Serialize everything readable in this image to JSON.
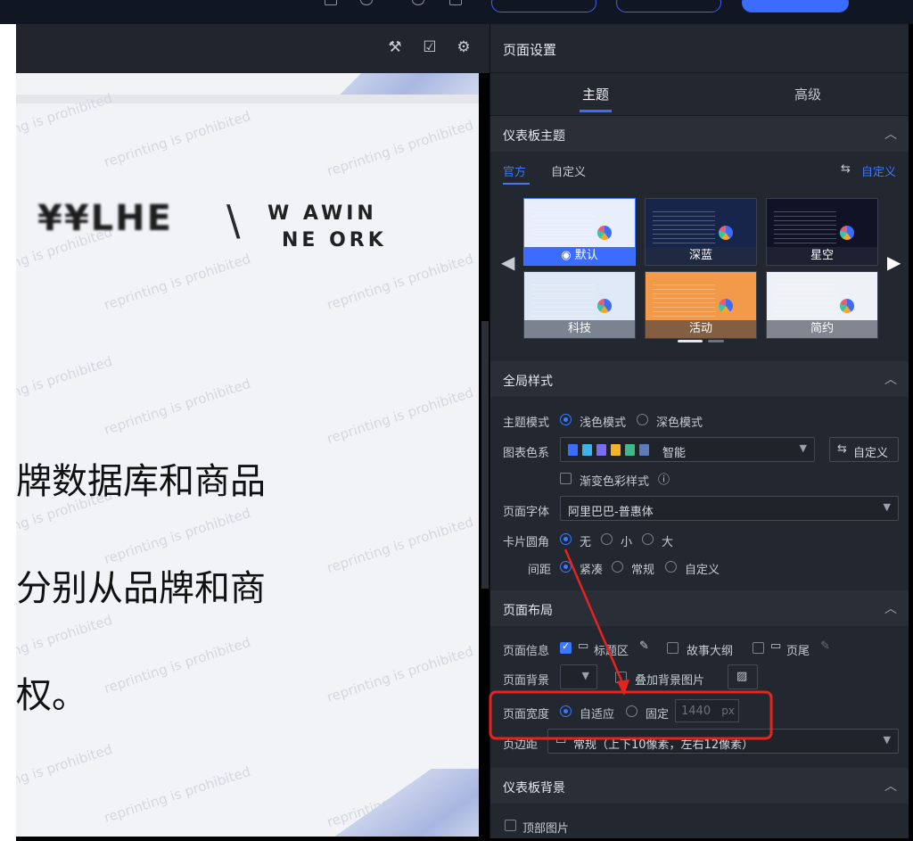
{
  "canvas": {
    "logo_left": "¥¥LHE",
    "logo_slash": "\\",
    "logo_right_line1": "W  AWIN",
    "logo_right_line2": "NE  ORK",
    "watermark": "reprinting is prohibited",
    "text_line1": "牌数据库和商品",
    "text_line2": "分别从品牌和商",
    "text_line3": "权。"
  },
  "panel": {
    "title": "页面设置",
    "tabs": [
      "主题",
      "高级"
    ],
    "dashboard_theme": {
      "heading": "仪表板主题",
      "subtabs": [
        "官方",
        "自定义"
      ],
      "custom_link": "自定义",
      "themes": [
        {
          "name": "默认",
          "bg": "#e9eefb",
          "selected": true
        },
        {
          "name": "深蓝",
          "bg": "#17254a"
        },
        {
          "name": "星空",
          "bg": "#101226"
        },
        {
          "name": "科技",
          "bg": "#dfe8f6"
        },
        {
          "name": "活动",
          "bg": "#f29a4a"
        },
        {
          "name": "简约",
          "bg": "#eef1f6"
        }
      ]
    },
    "global_style": {
      "heading": "全局样式",
      "theme_mode_label": "主题模式",
      "theme_mode_options": [
        "浅色模式",
        "深色模式"
      ],
      "chart_colors_label": "图表色系",
      "chart_colors_value": "智能",
      "chart_swatches": [
        "#3b6bff",
        "#3db3e8",
        "#7b6cf0",
        "#f5b32a",
        "#3fb88a",
        "#5b7bbd"
      ],
      "custom_button": "自定义",
      "gradient_label": "渐变色彩样式",
      "font_label": "页面字体",
      "font_value": "阿里巴巴-普惠体",
      "radius_label": "卡片圆角",
      "radius_options": [
        "无",
        "小",
        "大"
      ],
      "spacing_label": "间距",
      "spacing_options": [
        "紧凑",
        "常规",
        "自定义"
      ]
    },
    "page_layout": {
      "heading": "页面布局",
      "info_label": "页面信息",
      "info_title": "标题区",
      "info_story": "故事大纲",
      "info_footer": "页尾",
      "bg_label": "页面背景",
      "bg_image_label": "叠加背景图片",
      "width_label": "页面宽度",
      "width_options": [
        "自适应",
        "固定"
      ],
      "width_value": "1440",
      "width_unit": "px",
      "margin_label": "页边距",
      "margin_value": "常规（上下10像素，左右12像素）"
    },
    "dashboard_bg": {
      "heading": "仪表板背景",
      "top_image_label": "顶部图片"
    }
  }
}
